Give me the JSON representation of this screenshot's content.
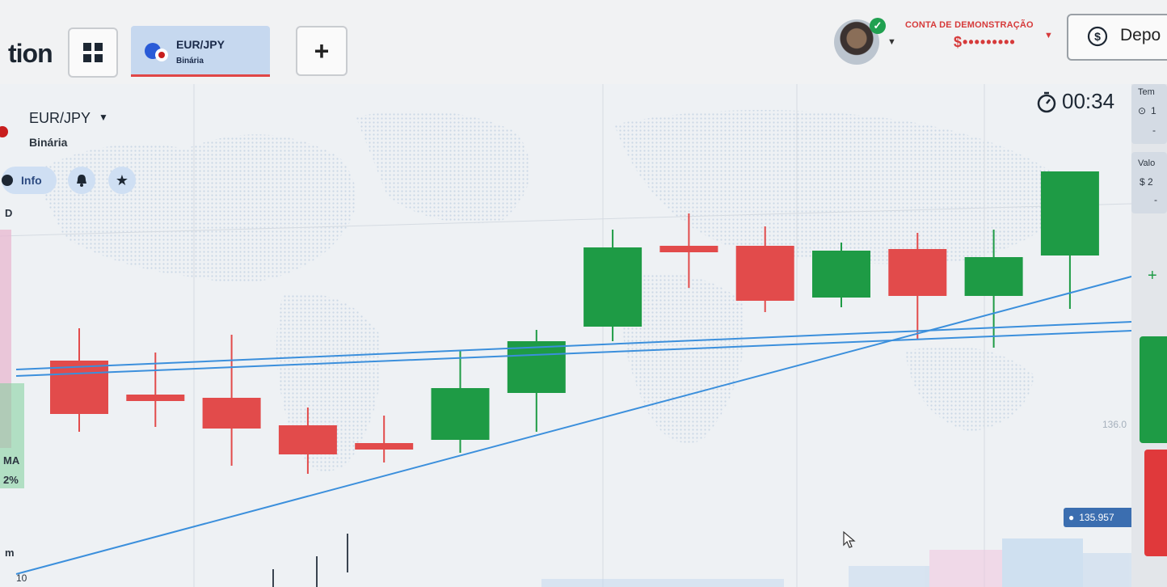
{
  "header": {
    "brand": "tion",
    "active_tab": {
      "pair": "EUR/JPY",
      "type": "Binária"
    },
    "add_tab": "+",
    "account": {
      "label": "CONTA DE DEMONSTRAÇÃO",
      "balance": "$•••••••••"
    },
    "deposit": "Depo"
  },
  "chart_header": {
    "pair": "EUR/JPY",
    "type": "Binária",
    "info": "Info",
    "timer": "00:34"
  },
  "left_labels": {
    "label_a": "D",
    "label_b": "MA",
    "label_c": "2%",
    "label_d": "m"
  },
  "right_panel": {
    "time_label": "Tem",
    "time_value": "1",
    "time_minus": "-",
    "value_label": "Valo",
    "value_amount": "$ 2",
    "value_minus": "-",
    "plus": "+"
  },
  "price": {
    "current": "135.957",
    "scale_tick": "136.0",
    "bottom_tick": "10"
  },
  "colors": {
    "bullish": "#1e9b45",
    "bearish": "#e24b4b",
    "trendline": "#3b8fdc"
  },
  "chart_data": {
    "type": "candlestick",
    "pair": "EUR/JPY",
    "price_ticks": [
      "136.0",
      "10"
    ],
    "current_price": 135.957,
    "candles": [
      {
        "open": 135.985,
        "close": 135.952,
        "high": 136.005,
        "low": 135.941
      },
      {
        "open": 135.964,
        "close": 135.962,
        "high": 135.99,
        "low": 135.944
      },
      {
        "open": 135.962,
        "close": 135.943,
        "high": 136.001,
        "low": 135.92
      },
      {
        "open": 135.945,
        "close": 135.927,
        "high": 135.956,
        "low": 135.915
      },
      {
        "open": 135.934,
        "close": 135.931,
        "high": 135.951,
        "low": 135.922
      },
      {
        "open": 135.936,
        "close": 135.968,
        "high": 135.991,
        "low": 135.928
      },
      {
        "open": 135.965,
        "close": 135.997,
        "high": 136.004,
        "low": 135.941
      },
      {
        "open": 136.006,
        "close": 136.055,
        "high": 136.066,
        "low": 135.997
      },
      {
        "open": 136.056,
        "close": 136.054,
        "high": 136.076,
        "low": 136.03
      },
      {
        "open": 136.056,
        "close": 136.022,
        "high": 136.068,
        "low": 136.015
      },
      {
        "open": 136.024,
        "close": 136.053,
        "high": 136.058,
        "low": 136.018
      },
      {
        "open": 136.054,
        "close": 136.025,
        "high": 136.064,
        "low": 135.998
      },
      {
        "open": 136.025,
        "close": 136.049,
        "high": 136.066,
        "low": 135.993
      },
      {
        "open": 136.05,
        "close": 136.102,
        "high": 136.102,
        "low": 136.017
      }
    ]
  }
}
